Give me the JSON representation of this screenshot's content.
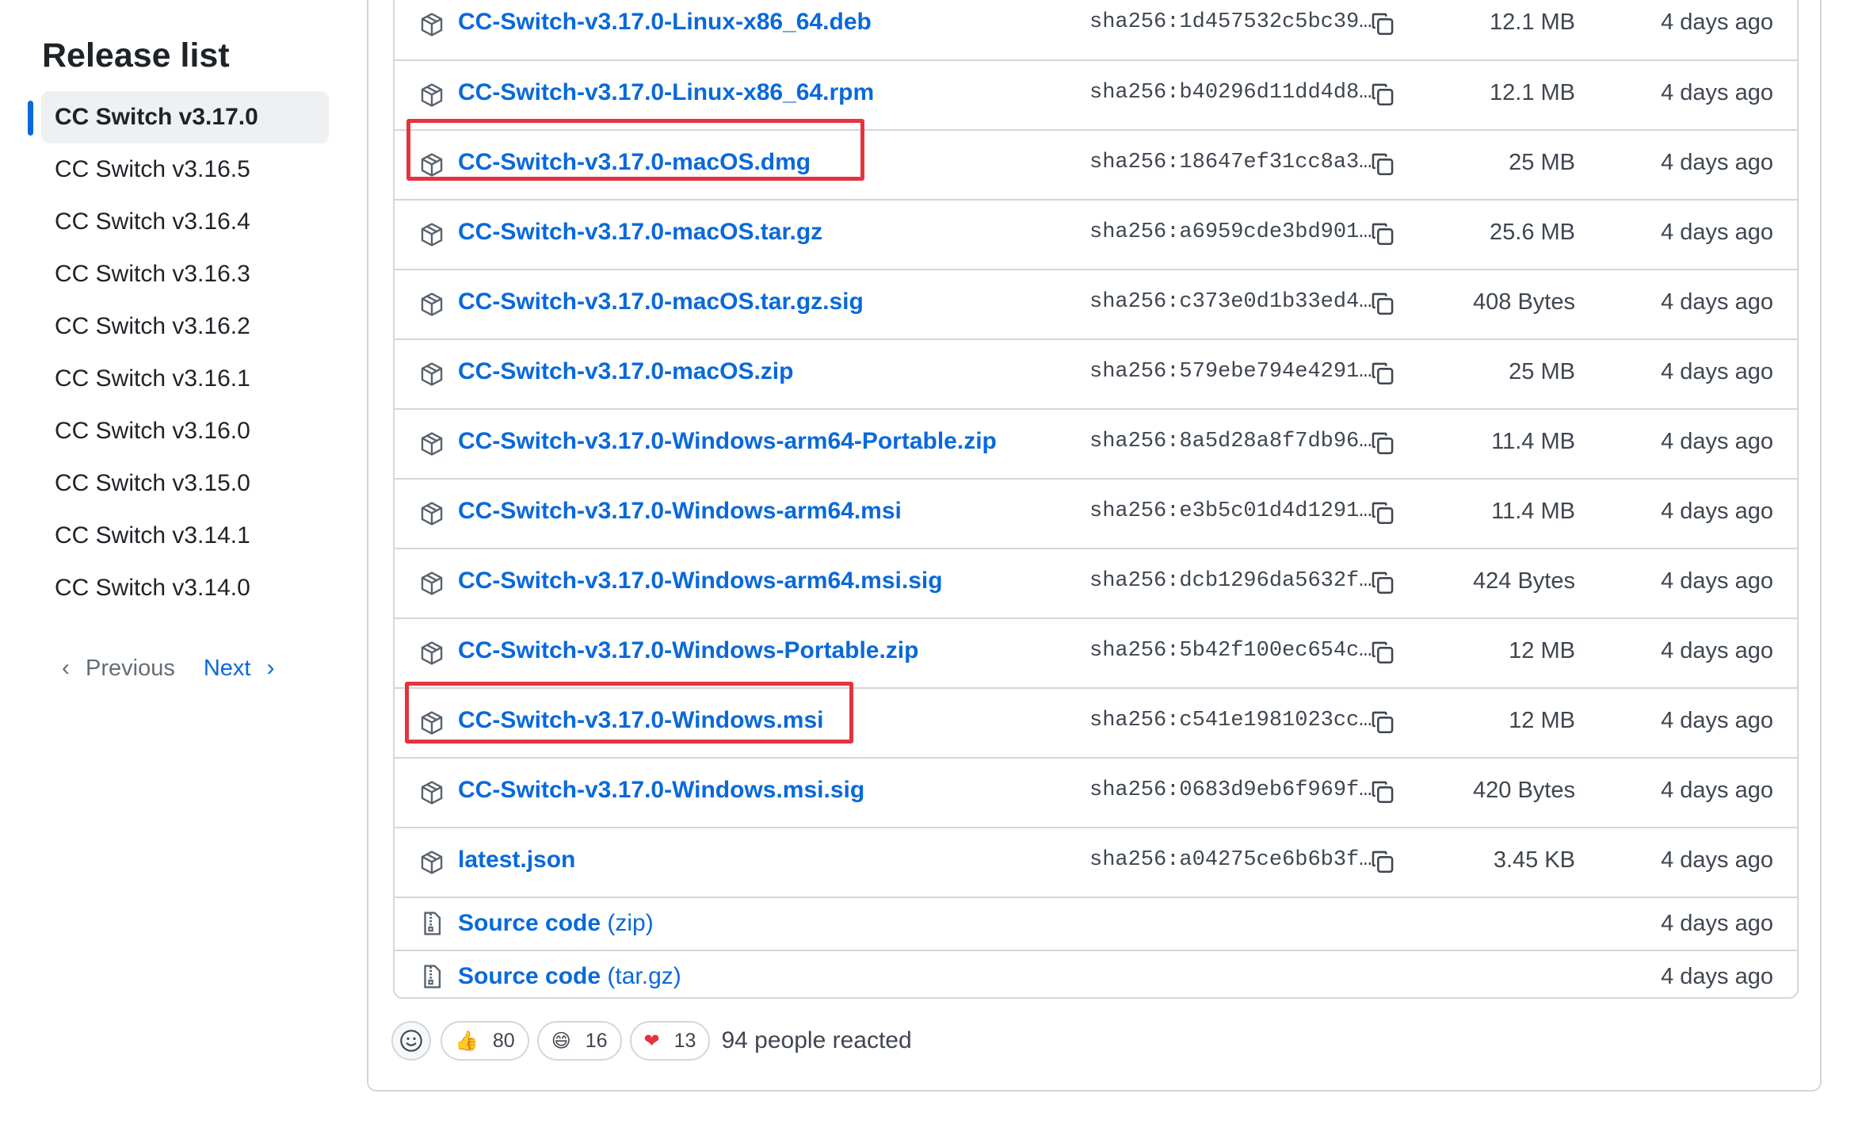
{
  "sidebar": {
    "title": "Release list",
    "items": [
      {
        "label": "CC Switch v3.17.0",
        "active": true
      },
      {
        "label": "CC Switch v3.16.5",
        "active": false
      },
      {
        "label": "CC Switch v3.16.4",
        "active": false
      },
      {
        "label": "CC Switch v3.16.3",
        "active": false
      },
      {
        "label": "CC Switch v3.16.2",
        "active": false
      },
      {
        "label": "CC Switch v3.16.1",
        "active": false
      },
      {
        "label": "CC Switch v3.16.0",
        "active": false
      },
      {
        "label": "CC Switch v3.15.0",
        "active": false
      },
      {
        "label": "CC Switch v3.14.1",
        "active": false
      },
      {
        "label": "CC Switch v3.14.0",
        "active": false
      }
    ],
    "pager": {
      "previous": "Previous",
      "next": "Next"
    }
  },
  "assets": [
    {
      "name": "CC-Switch-v3.17.0-Linux-x86_64.deb",
      "sha": "sha256:1d457532c5bc39…",
      "size": "12.1 MB",
      "date": "4 days ago"
    },
    {
      "name": "CC-Switch-v3.17.0-Linux-x86_64.rpm",
      "sha": "sha256:b40296d11dd4d8…",
      "size": "12.1 MB",
      "date": "4 days ago"
    },
    {
      "name": "CC-Switch-v3.17.0-macOS.dmg",
      "sha": "sha256:18647ef31cc8a3…",
      "size": "25 MB",
      "date": "4 days ago",
      "highlighted": true
    },
    {
      "name": "CC-Switch-v3.17.0-macOS.tar.gz",
      "sha": "sha256:a6959cde3bd901…",
      "size": "25.6 MB",
      "date": "4 days ago"
    },
    {
      "name": "CC-Switch-v3.17.0-macOS.tar.gz.sig",
      "sha": "sha256:c373e0d1b33ed4…",
      "size": "408 Bytes",
      "date": "4 days ago"
    },
    {
      "name": "CC-Switch-v3.17.0-macOS.zip",
      "sha": "sha256:579ebe794e4291…",
      "size": "25 MB",
      "date": "4 days ago"
    },
    {
      "name": "CC-Switch-v3.17.0-Windows-arm64-Portable.zip",
      "sha": "sha256:8a5d28a8f7db96…",
      "size": "11.4 MB",
      "date": "4 days ago"
    },
    {
      "name": "CC-Switch-v3.17.0-Windows-arm64.msi",
      "sha": "sha256:e3b5c01d4d1291…",
      "size": "11.4 MB",
      "date": "4 days ago"
    },
    {
      "name": "CC-Switch-v3.17.0-Windows-arm64.msi.sig",
      "sha": "sha256:dcb1296da5632f…",
      "size": "424 Bytes",
      "date": "4 days ago"
    },
    {
      "name": "CC-Switch-v3.17.0-Windows-Portable.zip",
      "sha": "sha256:5b42f100ec654c…",
      "size": "12 MB",
      "date": "4 days ago"
    },
    {
      "name": "CC-Switch-v3.17.0-Windows.msi",
      "sha": "sha256:c541e1981023cc…",
      "size": "12 MB",
      "date": "4 days ago",
      "highlighted": true
    },
    {
      "name": "CC-Switch-v3.17.0-Windows.msi.sig",
      "sha": "sha256:0683d9eb6f969f…",
      "size": "420 Bytes",
      "date": "4 days ago"
    },
    {
      "name": "latest.json",
      "sha": "sha256:a04275ce6b6b3f…",
      "size": "3.45 KB",
      "date": "4 days ago"
    }
  ],
  "source_code": [
    {
      "label": "Source code",
      "format": "(zip)",
      "date": "4 days ago"
    },
    {
      "label": "Source code",
      "format": "(tar.gz)",
      "date": "4 days ago"
    }
  ],
  "reactions": {
    "items": [
      {
        "emoji": "👍",
        "count": "80"
      },
      {
        "emoji": "😄",
        "count": "16"
      },
      {
        "emoji": "❤",
        "count": "13"
      }
    ],
    "summary": "94 people reacted"
  },
  "colors": {
    "link": "#0969da",
    "highlight": "#e5333e",
    "border": "#d0d7de"
  }
}
